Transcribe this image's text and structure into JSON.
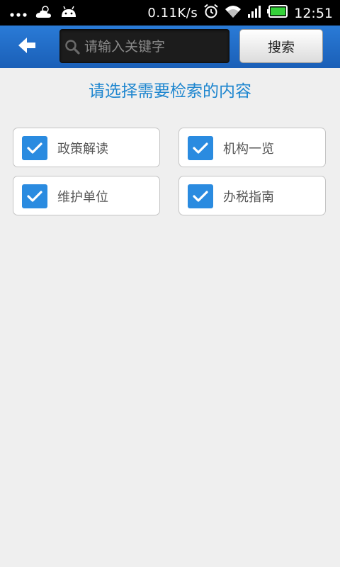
{
  "status_bar": {
    "network_speed": "0.11K/s",
    "time": "12:51",
    "icons": [
      "overflow-dots-icon",
      "weather-icon",
      "android-icon",
      "alarm-icon",
      "wifi-icon",
      "signal-icon",
      "battery-icon"
    ]
  },
  "toolbar": {
    "search_placeholder": "请输入关键字",
    "search_value": "",
    "search_button_label": "搜索"
  },
  "prompt": "请选择需要检索的内容",
  "options": [
    {
      "label": "政策解读",
      "checked": true
    },
    {
      "label": "机构一览",
      "checked": true
    },
    {
      "label": "维护单位",
      "checked": true
    },
    {
      "label": "办税指南",
      "checked": true
    }
  ],
  "colors": {
    "toolbar_blue": "#2a7bd7",
    "accent_blue": "#1e86cf",
    "checkbox_blue": "#2a8be0",
    "background": "#efefef"
  }
}
